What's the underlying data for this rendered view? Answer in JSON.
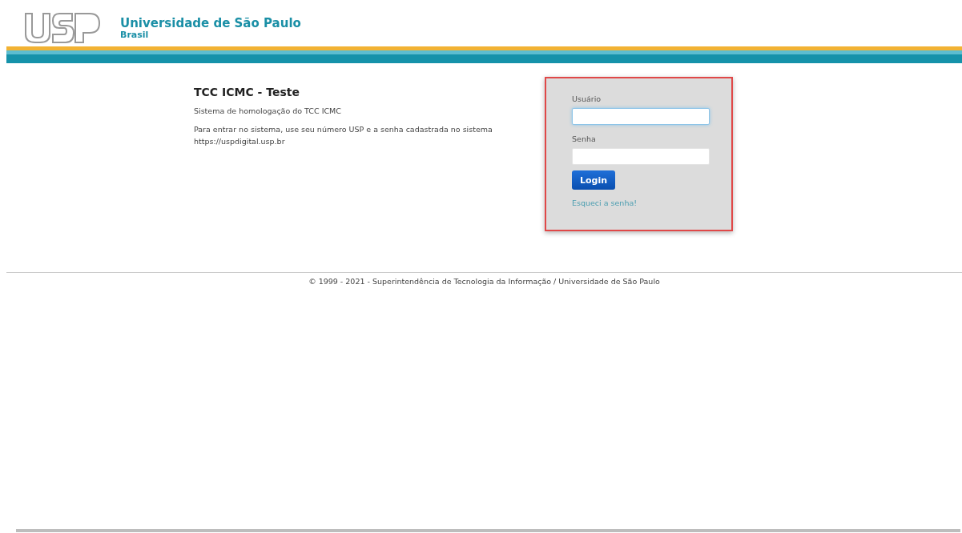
{
  "header": {
    "title": "Universidade de São Paulo",
    "subtitle": "Brasil"
  },
  "intro": {
    "title": "TCC ICMC - Teste",
    "description": "Sistema de homologação do TCC ICMC",
    "instructions": "Para entrar no sistema, use seu número USP e a senha cadastrada no sistema https://uspdigital.usp.br"
  },
  "login": {
    "fields": [
      {
        "label": "Usuário",
        "focused": true
      },
      {
        "label": "Senha",
        "focused": false
      }
    ],
    "button": "Login",
    "forgot_link": "Esqueci a senha!"
  },
  "footer": {
    "text": "© 1999 - 2021 - Superintendência de Tecnologia da Informação / Universidade de São Paulo"
  }
}
